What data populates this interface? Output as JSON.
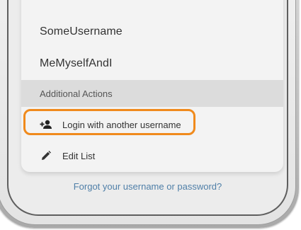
{
  "accounts": [
    {
      "name": "SomeUsername"
    },
    {
      "name": "MeMyselfAndI"
    }
  ],
  "additional_actions": {
    "header": "Additional Actions",
    "items": [
      {
        "label": "Login with another username",
        "icon": "add-person-icon"
      },
      {
        "label": "Edit List",
        "icon": "pencil-icon"
      }
    ]
  },
  "forgot_link": "Forgot your username or password?",
  "colors": {
    "highlight": "#f08a1c",
    "link": "#4f7fa8",
    "section_bg": "#dcdcdc"
  }
}
